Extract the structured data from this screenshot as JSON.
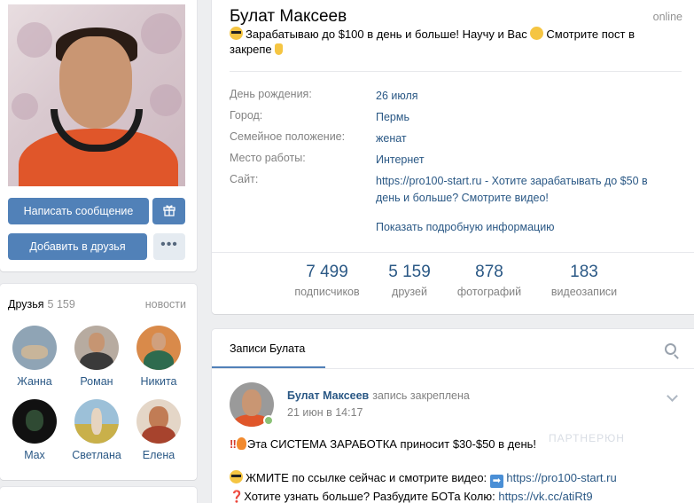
{
  "profile": {
    "name": "Булат Максеев",
    "online": "online",
    "status_text": "Зарабатываю до $100 в день и больше! Научу и Вас",
    "status_text_2": "Смотрите пост в закрепе",
    "buttons": {
      "message": "Написать сообщение",
      "add_friend": "Добавить в друзья"
    },
    "info": [
      {
        "label": "День рождения:",
        "value": "26 июля"
      },
      {
        "label": "Город:",
        "value": "Пермь"
      },
      {
        "label": "Семейное положение:",
        "value": "женат"
      },
      {
        "label": "Место работы:",
        "value": "Интернет"
      }
    ],
    "site": {
      "label": "Сайт:",
      "link": "https://pro100-start.ru",
      "description": " - Хотите зарабатывать до $50 в день и больше? Смотрите видео!"
    },
    "show_more": "Показать подробную информацию",
    "counters": [
      {
        "num": "7 499",
        "label": "подписчиков"
      },
      {
        "num": "5 159",
        "label": "друзей"
      },
      {
        "num": "878",
        "label": "фотографий"
      },
      {
        "num": "183",
        "label": "видеозаписи"
      }
    ]
  },
  "friends": {
    "title": "Друзья",
    "count": "5 159",
    "news": "новости",
    "items": [
      {
        "name": "Жанна",
        "color": "#8fa4b5"
      },
      {
        "name": "Роман",
        "color": "#7a6a5e"
      },
      {
        "name": "Никита",
        "color": "#2e6b4e"
      },
      {
        "name": "Max",
        "color": "#1f2a22"
      },
      {
        "name": "Светлана",
        "color": "#c9b04a"
      },
      {
        "name": "Елена",
        "color": "#a7432d"
      }
    ]
  },
  "wall": {
    "tab": "Записи Булата",
    "post": {
      "author": "Булат Максеев",
      "pinned": "запись закреплена",
      "date": "21 июн в 14:17",
      "line1": "Эта СИСТЕМА ЗАРАБОТКА приносит $30-$50 в день!",
      "line2_text": "ЖМИТЕ по ссылке сейчас и смотрите видео:",
      "line2_link": "https://pro100-start.ru",
      "line3_text": "Хотите узнать больше? Разбудите БОТа Колю:",
      "line3_link": "https://vk.cc/atiRt9",
      "watermark": "ПАРТНЕРЮН"
    }
  },
  "colors": {
    "accent": "#5181b8",
    "link": "#2a5885",
    "background": "#edeef0",
    "online": "#8ac176"
  }
}
